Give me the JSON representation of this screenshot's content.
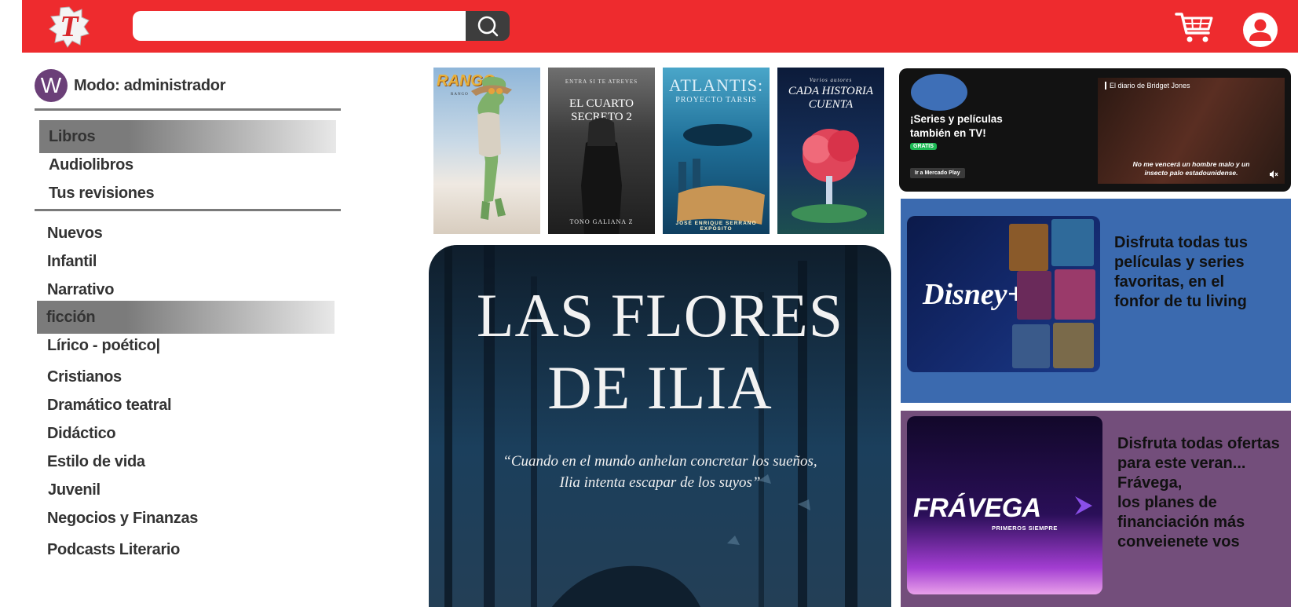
{
  "header": {
    "logo_letter": "T",
    "logo_icon": "red-t-logo-icon",
    "search": {
      "value": "",
      "placeholder": "",
      "icon": "search-icon"
    },
    "cart_icon": "cart-icon",
    "account_icon": "user-account-icon"
  },
  "sidebar": {
    "avatar_letter": "W",
    "mode_label": "Modo: administrador",
    "primary_items": [
      {
        "label": "Libros",
        "active": true
      },
      {
        "label": "Audiolibros",
        "active": false
      },
      {
        "label": "Tus revisiones",
        "active": false
      }
    ],
    "categories": [
      {
        "label": "Nuevos",
        "active": false
      },
      {
        "label": "Infantil",
        "active": false
      },
      {
        "label": "Narrativo",
        "active": false
      },
      {
        "label": "ficción",
        "active": true
      },
      {
        "label": "Lírico - poético|",
        "active": false
      },
      {
        "label": "Cristianos",
        "active": false
      },
      {
        "label": "Dramático teatral",
        "active": false
      },
      {
        "label": "Didáctico",
        "active": false
      },
      {
        "label": "Estilo de vida",
        "active": false
      },
      {
        "label": "Juvenil",
        "active": false
      },
      {
        "label": "Negocios y Finanzas",
        "active": false
      },
      {
        "label": "Podcasts Literario",
        "active": false
      }
    ]
  },
  "books": [
    {
      "title": "RANGO",
      "subtitle": "RANGO"
    },
    {
      "title": "EL CUARTO SECRETO 2",
      "subtitle": "ENTRA SI TE ATREVES",
      "author": "TONO GALIANA Z"
    },
    {
      "title": "ATLANTIS:",
      "subtitle": "PROYECTO TARSIS",
      "author": "JOSÉ ENRIQUE SERRANO EXPÓSITO"
    },
    {
      "title": "CADA HISTORIA CUENTA",
      "subtitle": "Varios autores"
    }
  ],
  "featured_book": {
    "title_line1": "LAS FLORES",
    "title_line2": "DE ILIA",
    "quote_line1": "“Cuando en el mundo anhelan concretar los sueños,",
    "quote_line2": "Ilia intenta escapar de los suyos”"
  },
  "ads": {
    "mercado": {
      "headline": "¡Series y películas también en TV!",
      "badge": "GRATIS",
      "button": "Ir a Mercado Play",
      "video_title": "El diario de Bridget Jones",
      "caption": "No me vencerá un hombre malo y un insecto palo estadounidense.",
      "mute_icon": "mute-icon"
    },
    "disney": {
      "brand": "Disney+",
      "text": "Disfruta todas tus películas y series favoritas, en el fonfor de tu living"
    },
    "fravega": {
      "brand": "FRÁVEGA",
      "tagline": "PRIMEROS SIEMPRE",
      "text_line1": "Disfruta todas ofertas para este veran...",
      "text_line2": "Frávega,",
      "text_line3": "los planes de financiación más conveienete vos"
    }
  },
  "colors": {
    "header_red": "#ee2b2e",
    "disney_blue": "#3b6aaf",
    "fravega_purple": "#734e7b",
    "avatar_purple": "#6b3f78"
  }
}
